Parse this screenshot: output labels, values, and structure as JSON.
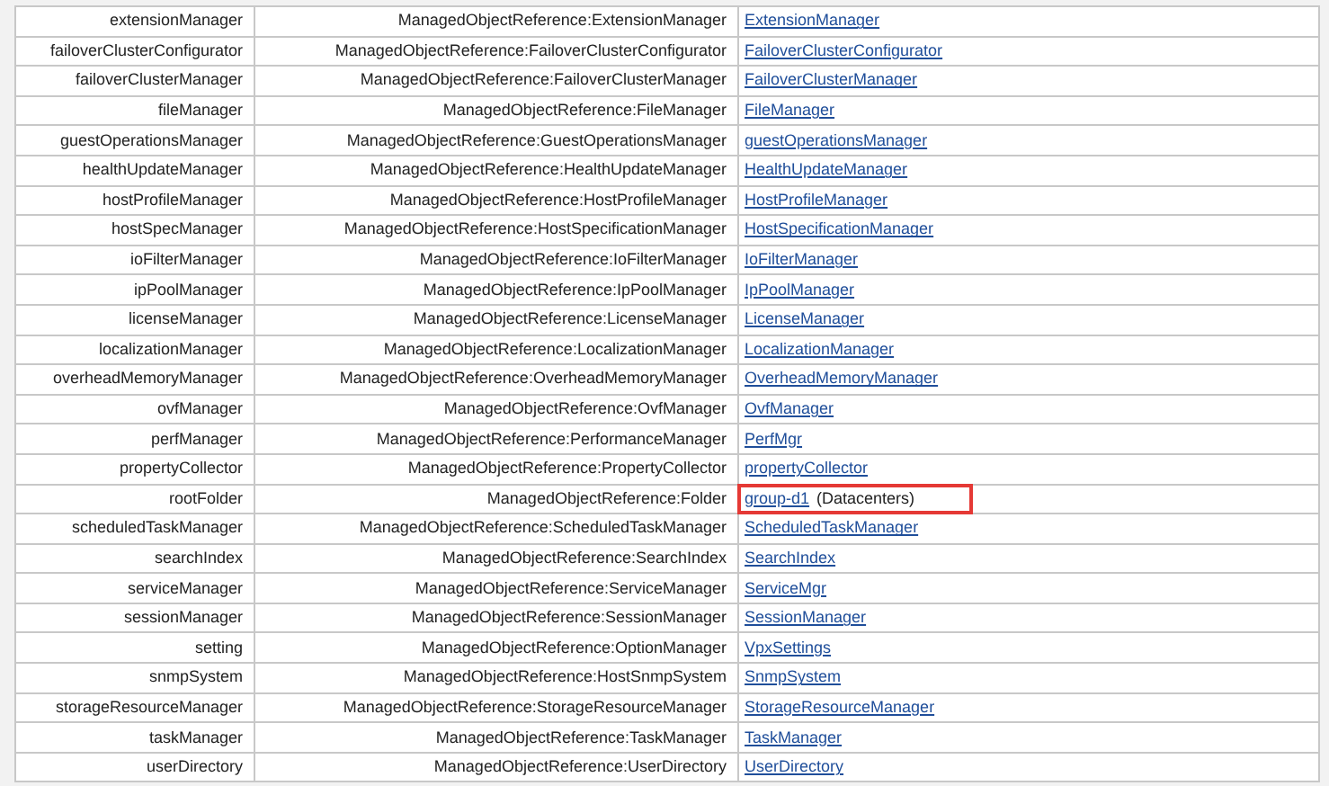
{
  "rows": [
    {
      "name": "extensionManager",
      "type": "ManagedObjectReference:ExtensionManager",
      "value": "ExtensionManager",
      "highlighted": false
    },
    {
      "name": "failoverClusterConfigurator",
      "type": "ManagedObjectReference:FailoverClusterConfigurator",
      "value": "FailoverClusterConfigurator",
      "highlighted": false
    },
    {
      "name": "failoverClusterManager",
      "type": "ManagedObjectReference:FailoverClusterManager",
      "value": "FailoverClusterManager",
      "highlighted": false
    },
    {
      "name": "fileManager",
      "type": "ManagedObjectReference:FileManager",
      "value": "FileManager",
      "highlighted": false
    },
    {
      "name": "guestOperationsManager",
      "type": "ManagedObjectReference:GuestOperationsManager",
      "value": "guestOperationsManager",
      "highlighted": false
    },
    {
      "name": "healthUpdateManager",
      "type": "ManagedObjectReference:HealthUpdateManager",
      "value": "HealthUpdateManager",
      "highlighted": false
    },
    {
      "name": "hostProfileManager",
      "type": "ManagedObjectReference:HostProfileManager",
      "value": "HostProfileManager",
      "highlighted": false
    },
    {
      "name": "hostSpecManager",
      "type": "ManagedObjectReference:HostSpecificationManager",
      "value": "HostSpecificationManager",
      "highlighted": false
    },
    {
      "name": "ioFilterManager",
      "type": "ManagedObjectReference:IoFilterManager",
      "value": "IoFilterManager",
      "highlighted": false
    },
    {
      "name": "ipPoolManager",
      "type": "ManagedObjectReference:IpPoolManager",
      "value": "IpPoolManager",
      "highlighted": false
    },
    {
      "name": "licenseManager",
      "type": "ManagedObjectReference:LicenseManager",
      "value": "LicenseManager",
      "highlighted": false
    },
    {
      "name": "localizationManager",
      "type": "ManagedObjectReference:LocalizationManager",
      "value": "LocalizationManager",
      "highlighted": false
    },
    {
      "name": "overheadMemoryManager",
      "type": "ManagedObjectReference:OverheadMemoryManager",
      "value": "OverheadMemoryManager",
      "highlighted": false
    },
    {
      "name": "ovfManager",
      "type": "ManagedObjectReference:OvfManager",
      "value": "OvfManager",
      "highlighted": false
    },
    {
      "name": "perfManager",
      "type": "ManagedObjectReference:PerformanceManager",
      "value": "PerfMgr",
      "highlighted": false
    },
    {
      "name": "propertyCollector",
      "type": "ManagedObjectReference:PropertyCollector",
      "value": "propertyCollector",
      "highlighted": false
    },
    {
      "name": "rootFolder",
      "type": "ManagedObjectReference:Folder",
      "value": "group-d1",
      "note": "(Datacenters)",
      "highlighted": true
    },
    {
      "name": "scheduledTaskManager",
      "type": "ManagedObjectReference:ScheduledTaskManager",
      "value": "ScheduledTaskManager",
      "highlighted": false
    },
    {
      "name": "searchIndex",
      "type": "ManagedObjectReference:SearchIndex",
      "value": "SearchIndex",
      "highlighted": false
    },
    {
      "name": "serviceManager",
      "type": "ManagedObjectReference:ServiceManager",
      "value": "ServiceMgr",
      "highlighted": false
    },
    {
      "name": "sessionManager",
      "type": "ManagedObjectReference:SessionManager",
      "value": "SessionManager",
      "highlighted": false
    },
    {
      "name": "setting",
      "type": "ManagedObjectReference:OptionManager",
      "value": "VpxSettings",
      "highlighted": false
    },
    {
      "name": "snmpSystem",
      "type": "ManagedObjectReference:HostSnmpSystem",
      "value": "SnmpSystem",
      "highlighted": false
    },
    {
      "name": "storageResourceManager",
      "type": "ManagedObjectReference:StorageResourceManager",
      "value": "StorageResourceManager",
      "highlighted": false
    },
    {
      "name": "taskManager",
      "type": "ManagedObjectReference:TaskManager",
      "value": "TaskManager",
      "highlighted": false
    },
    {
      "name": "userDirectory",
      "type": "ManagedObjectReference:UserDirectory",
      "value": "UserDirectory",
      "highlighted": false
    }
  ]
}
